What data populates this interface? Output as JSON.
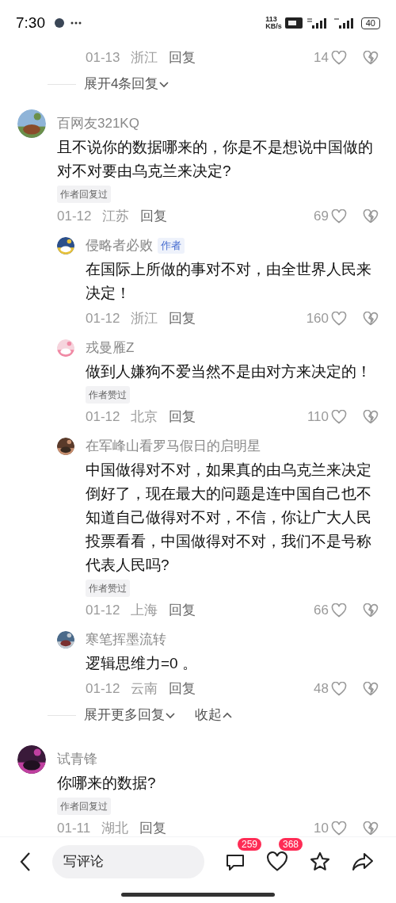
{
  "status_bar": {
    "time": "7:30",
    "speed_value": "113",
    "speed_unit": "KB/s",
    "battery": "40"
  },
  "items": [
    {
      "kind": "reply",
      "date": "01-13",
      "region": "浙江",
      "reply_label": "回复",
      "likes": "14"
    },
    {
      "kind": "expand",
      "label": "展开4条回复"
    },
    {
      "kind": "comment",
      "name": "百网友321KQ",
      "text": "且不说你的数据哪来的，你是不是想说中国做的对不对要由乌克兰来决定?",
      "tag": "作者回复过",
      "date": "01-12",
      "region": "江苏",
      "reply_label": "回复",
      "likes": "69"
    },
    {
      "kind": "reply",
      "name": "侵略者必败",
      "badge": "作者",
      "text": "在国际上所做的事对不对，由全世界人民来决定！",
      "date": "01-12",
      "region": "浙江",
      "reply_label": "回复",
      "likes": "160"
    },
    {
      "kind": "reply",
      "name": "戎曼雁Z",
      "text": "做到人嫌狗不爱当然不是由对方来决定的！",
      "tag": "作者赞过",
      "date": "01-12",
      "region": "北京",
      "reply_label": "回复",
      "likes": "110"
    },
    {
      "kind": "reply",
      "name": "在军峰山看罗马假日的启明星",
      "text": "中国做得对不对，如果真的由乌克兰来决定倒好了，现在最大的问题是连中国自己也不知道自己做得对不对，不信，你让广大人民投票看看，中国做得对不对，我们不是号称代表人民吗?",
      "tag": "作者赞过",
      "date": "01-12",
      "region": "上海",
      "reply_label": "回复",
      "likes": "66"
    },
    {
      "kind": "reply",
      "name": "寒笔挥墨流转",
      "text": "逻辑思维力=0 。",
      "date": "01-12",
      "region": "云南",
      "reply_label": "回复",
      "likes": "48"
    },
    {
      "kind": "expand_more",
      "label": "展开更多回复",
      "collapse": "收起"
    },
    {
      "kind": "comment",
      "name": "试青锋",
      "text": "你哪来的数据?",
      "tag": "作者回复过",
      "date": "01-11",
      "region": "湖北",
      "reply_label": "回复",
      "likes": "10"
    }
  ],
  "bottom_bar": {
    "placeholder": "写评论",
    "comment_count": "259",
    "like_count": "368"
  }
}
